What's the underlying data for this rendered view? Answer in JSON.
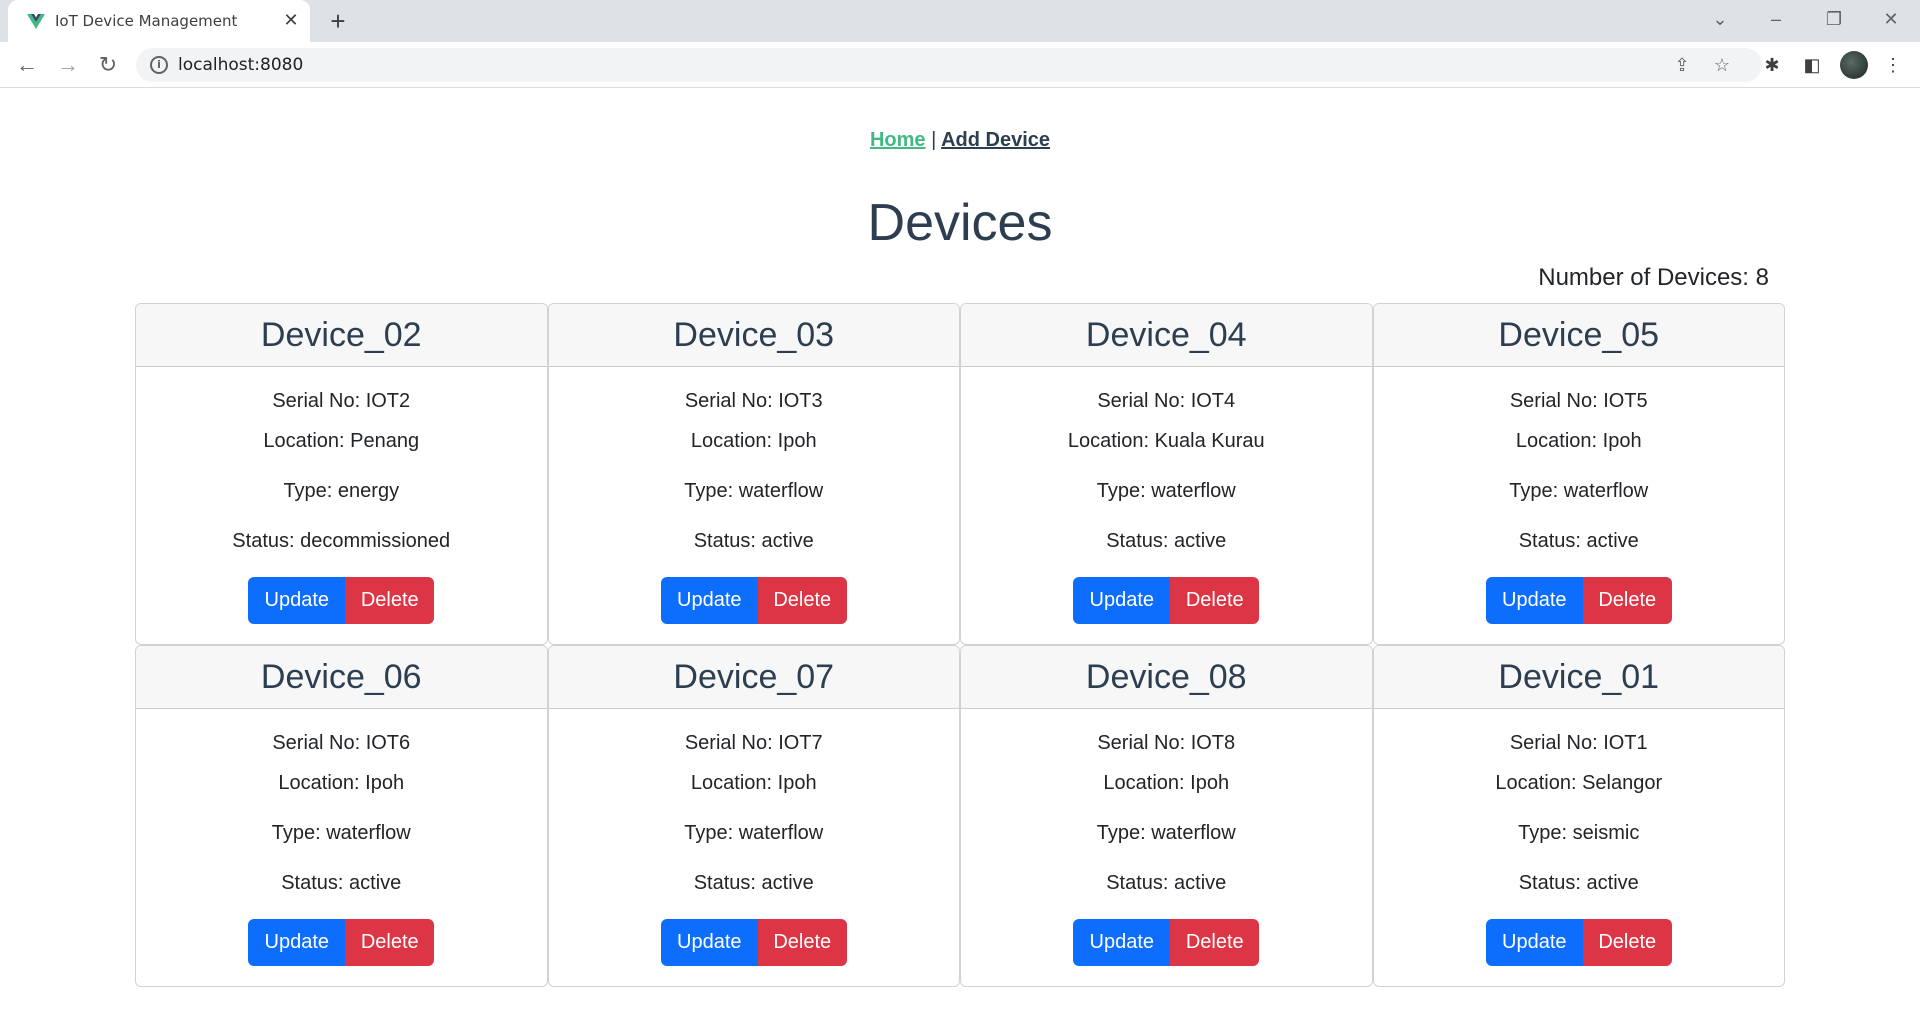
{
  "browser": {
    "tab_title": "IoT Device Management",
    "url": "localhost:8080"
  },
  "nav": {
    "home": "Home",
    "separator": "|",
    "add_device": "Add Device"
  },
  "page_title": "Devices",
  "count_label": "Number of Devices: 8",
  "labels": {
    "serial": "Serial No: ",
    "location": "Location: ",
    "type": "Type: ",
    "status": "Status: ",
    "update": "Update",
    "delete": "Delete"
  },
  "devices": [
    {
      "name": "Device_02",
      "serial": "Serial No: IOT2",
      "location": "Location: Penang",
      "type": "Type: energy",
      "status": "Status: decommissioned"
    },
    {
      "name": "Device_03",
      "serial": "Serial No: IOT3",
      "location": "Location: Ipoh",
      "type": "Type: waterflow",
      "status": "Status: active"
    },
    {
      "name": "Device_04",
      "serial": "Serial No: IOT4",
      "location": "Location: Kuala Kurau",
      "type": "Type: waterflow",
      "status": "Status: active"
    },
    {
      "name": "Device_05",
      "serial": "Serial No: IOT5",
      "location": "Location: Ipoh",
      "type": "Type: waterflow",
      "status": "Status: active"
    },
    {
      "name": "Device_06",
      "serial": "Serial No: IOT6",
      "location": "Location: Ipoh",
      "type": "Type: waterflow",
      "status": "Status: active"
    },
    {
      "name": "Device_07",
      "serial": "Serial No: IOT7",
      "location": "Location: Ipoh",
      "type": "Type: waterflow",
      "status": "Status: active"
    },
    {
      "name": "Device_08",
      "serial": "Serial No: IOT8",
      "location": "Location: Ipoh",
      "type": "Type: waterflow",
      "status": "Status: active"
    },
    {
      "name": "Device_01",
      "serial": "Serial No: IOT1",
      "location": "Location: Selangor",
      "type": "Type: seismic",
      "status": "Status: active"
    }
  ],
  "colors": {
    "update": "#0d6efd",
    "delete": "#dc3545",
    "active_link": "#42b983",
    "text": "#2c3e50"
  }
}
